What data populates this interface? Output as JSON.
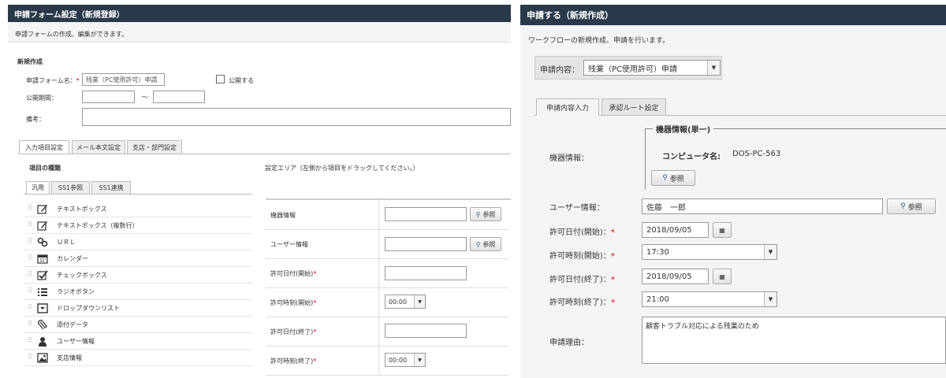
{
  "left": {
    "title": "申請フォーム設定（新規登録）",
    "description": "申請フォームの作成、編集ができます。",
    "section_title": "新規作成",
    "form_name_label": "申請フォーム名：",
    "required_mark": "*",
    "form_name_value": "残業（PC使用許可）申請",
    "publish_label": "公開する",
    "period_label": "公開期間：",
    "period_separator": "～",
    "note_label": "備考：",
    "tabs": [
      "入力項目設定",
      "メール本文設定",
      "支店・部門設定"
    ],
    "items_heading": "項目の種類",
    "area_heading": "設定エリア（左側から項目をドラッグしてください。）",
    "subtabs": [
      "汎用",
      "SS1参照",
      "SS1連携"
    ],
    "items": [
      {
        "label": "テキストボックス"
      },
      {
        "label": "テキストボックス（複数行）"
      },
      {
        "label": "ＵＲＬ"
      },
      {
        "label": "カレンダー"
      },
      {
        "label": "チェックボックス"
      },
      {
        "label": "ラジオボタン"
      },
      {
        "label": "ドロップダウンリスト"
      },
      {
        "label": "添付データ"
      },
      {
        "label": "ユーザー情報"
      },
      {
        "label": "支店情報"
      }
    ],
    "fields": {
      "device_info": "機器情報",
      "user_info": "ユーザー情報",
      "date_start": "許可日付(開始)",
      "time_start": "許可時刻(開始)",
      "date_end": "許可日付(終了)",
      "time_end": "許可時刻(終了)"
    },
    "ref_button": "参照",
    "time_default": "00:00"
  },
  "right": {
    "title": "申請する（新規作成）",
    "description": "ワークフローの新規作成、申請を行います。",
    "content_label": "申請内容：",
    "content_value": "残業（PC使用許可）申請",
    "tabs": [
      "申請内容入力",
      "承認ルート設定"
    ],
    "device_label": "機器情報：",
    "device_group": "機器情報(単一)",
    "computer_name_label": "コンピュータ名:",
    "computer_name_value": "DOS-PC-563",
    "ref_button": "参照",
    "user_label": "ユーザー情報：",
    "user_value": "佐藤　一郎",
    "date_start_label": "許可日付(開始)：",
    "date_start_value": "2018/09/05",
    "time_start_label": "許可時刻(開始)：",
    "time_start_value": "17:30",
    "date_end_label": "許可日付(終了)：",
    "date_end_value": "2018/09/05",
    "time_end_label": "許可時刻(終了)：",
    "time_end_value": "21:00",
    "reason_label": "申請理由：",
    "reason_value": "顧客トラブル対応による残業のため",
    "required_mark": "*"
  }
}
